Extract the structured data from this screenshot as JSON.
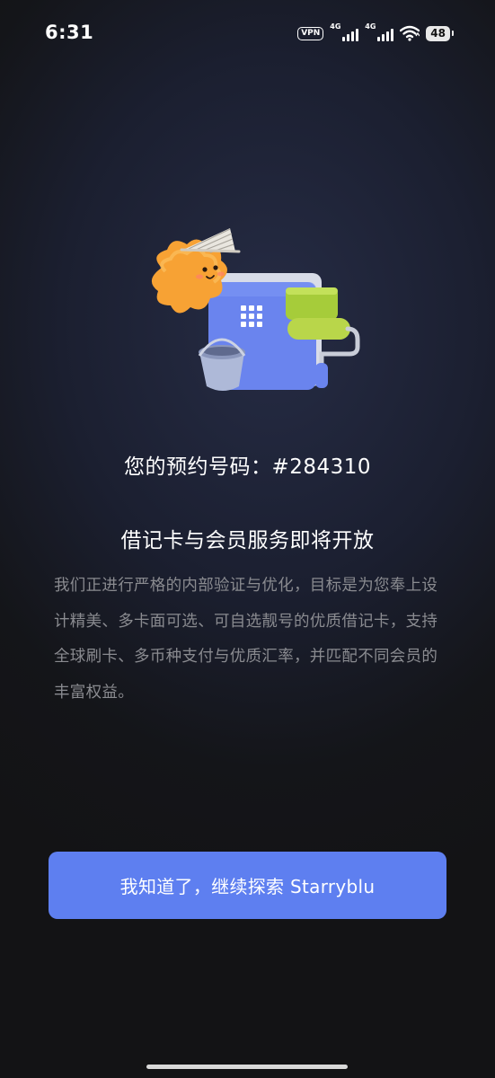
{
  "status_bar": {
    "time": "6:31",
    "vpn": "VPN",
    "network_1": "4G",
    "network_2": "4G",
    "battery": "48"
  },
  "content": {
    "reservation_text": "您的预约号码：#284310",
    "heading": "借记卡与会员服务即将开放",
    "description": "我们正进行严格的内部验证与优化，目标是为您奉上设计精美、多卡面可选、可自选靓号的优质借记卡，支持全球刷卡、多币种支付与优质汇率，并匹配不同会员的丰富权益。"
  },
  "actions": {
    "confirm_label": "我知道了，继续探索 Starryblu"
  },
  "colors": {
    "accent": "#5e7ff0",
    "card": "#6a84ee",
    "roller": "#a6cc3a",
    "mascot": "#f7a234"
  },
  "icons": [
    "vpn-icon",
    "signal-icon",
    "wifi-icon",
    "battery-icon"
  ]
}
